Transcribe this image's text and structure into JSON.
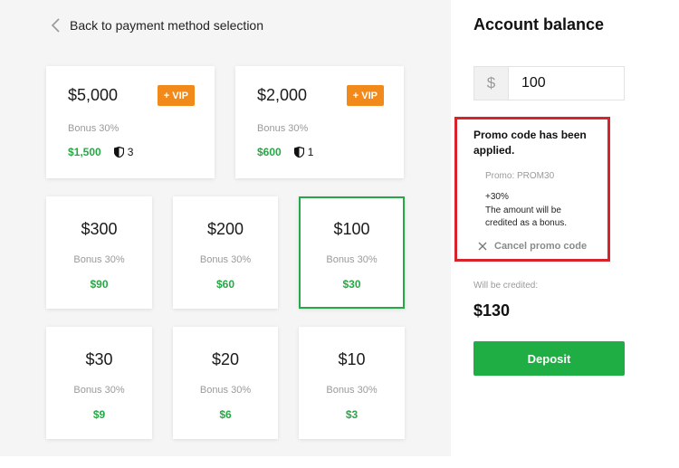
{
  "nav": {
    "back_label": "Back to payment method selection"
  },
  "vip_cards": [
    {
      "amount": "$5,000",
      "badge": "+ VIP",
      "bonus": "Bonus 30%",
      "credit": "$1,500",
      "shield_count": "3"
    },
    {
      "amount": "$2,000",
      "badge": "+ VIP",
      "bonus": "Bonus 30%",
      "credit": "$600",
      "shield_count": "1"
    }
  ],
  "cards": [
    {
      "amount": "$300",
      "bonus": "Bonus 30%",
      "credit": "$90"
    },
    {
      "amount": "$200",
      "bonus": "Bonus 30%",
      "credit": "$60"
    },
    {
      "amount": "$100",
      "bonus": "Bonus 30%",
      "credit": "$30",
      "selected": true
    },
    {
      "amount": "$30",
      "bonus": "Bonus 30%",
      "credit": "$9"
    },
    {
      "amount": "$20",
      "bonus": "Bonus 30%",
      "credit": "$6"
    },
    {
      "amount": "$10",
      "bonus": "Bonus 30%",
      "credit": "$3"
    }
  ],
  "balance": {
    "title": "Account balance",
    "currency_symbol": "$",
    "amount_value": "100"
  },
  "promo": {
    "title": "Promo code has been applied.",
    "code_label": "Promo: PROM30",
    "percent": "+30%",
    "description": "The amount will be credited as a bonus.",
    "cancel_label": "Cancel promo code"
  },
  "credit": {
    "label": "Will be credited:",
    "value": "$130"
  },
  "deposit_label": "Deposit",
  "colors": {
    "accent_green": "#1fae43",
    "vip_orange": "#f28a1b",
    "highlight_red": "#d6232c",
    "selected_border": "#27a745"
  },
  "icons": {
    "back": "chevron-left-icon",
    "shield": "shield-icon",
    "close": "close-icon"
  }
}
